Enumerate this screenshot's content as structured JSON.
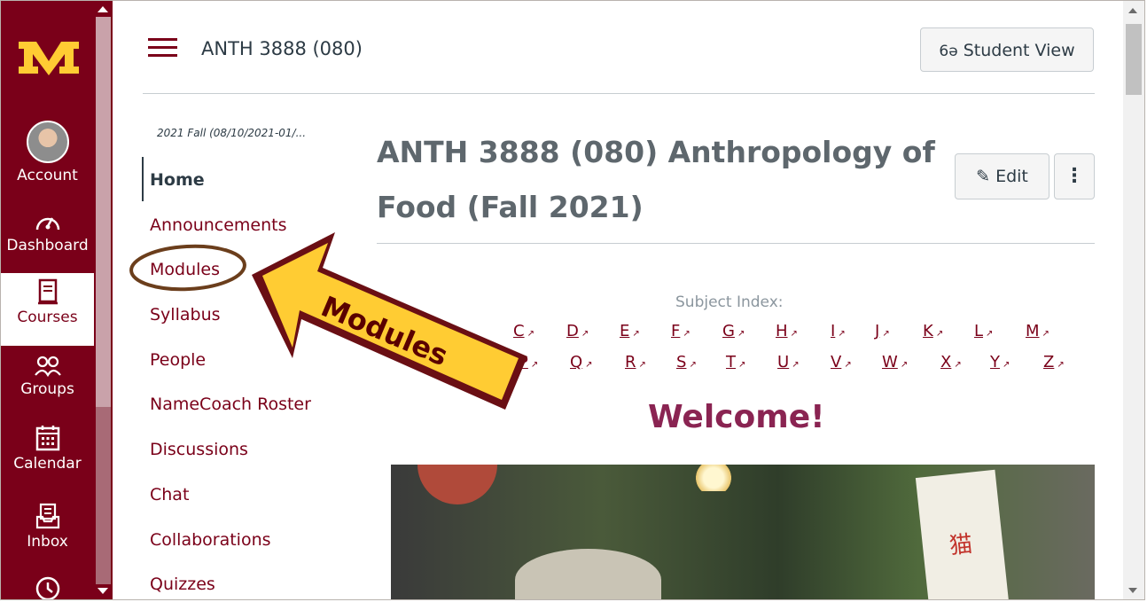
{
  "global_nav": {
    "logo": "M",
    "items": [
      {
        "label": "Account",
        "icon": "avatar"
      },
      {
        "label": "Dashboard",
        "icon": "dashboard-icon"
      },
      {
        "label": "Courses",
        "icon": "courses-icon",
        "active": true
      },
      {
        "label": "Groups",
        "icon": "groups-icon"
      },
      {
        "label": "Calendar",
        "icon": "calendar-icon"
      },
      {
        "label": "Inbox",
        "icon": "inbox-icon"
      },
      {
        "label": "",
        "icon": "history-icon"
      }
    ]
  },
  "header": {
    "breadcrumb": "ANTH 3888 (080)",
    "student_view_label": "Student View"
  },
  "course_nav": {
    "term": "2021 Fall (08/10/2021-01/...",
    "items": [
      "Home",
      "Announcements",
      "Modules",
      "Syllabus",
      "People",
      "NameCoach Roster",
      "Discussions",
      "Chat",
      "Collaborations",
      "Quizzes"
    ]
  },
  "content": {
    "title": "ANTH 3888 (080) Anthropology of Food (Fall 2021)",
    "edit_label": "Edit",
    "more_label": "⋮",
    "subject_index_label": "Subject Index:",
    "letters_row1": [
      "C",
      "D",
      "E",
      "F",
      "G",
      "H",
      "I",
      "J",
      "K",
      "L",
      "M"
    ],
    "letters_row2": [
      "P",
      "Q",
      "R",
      "S",
      "T",
      "U",
      "V",
      "W",
      "X",
      "Y",
      "Z"
    ],
    "welcome": "Welcome!",
    "photo_sign_text": "猫"
  },
  "annotation": {
    "arrow_text": "Modules"
  },
  "colors": {
    "brand": "#7a0019",
    "gold": "#ffcc33",
    "welcome": "#8a2452"
  }
}
